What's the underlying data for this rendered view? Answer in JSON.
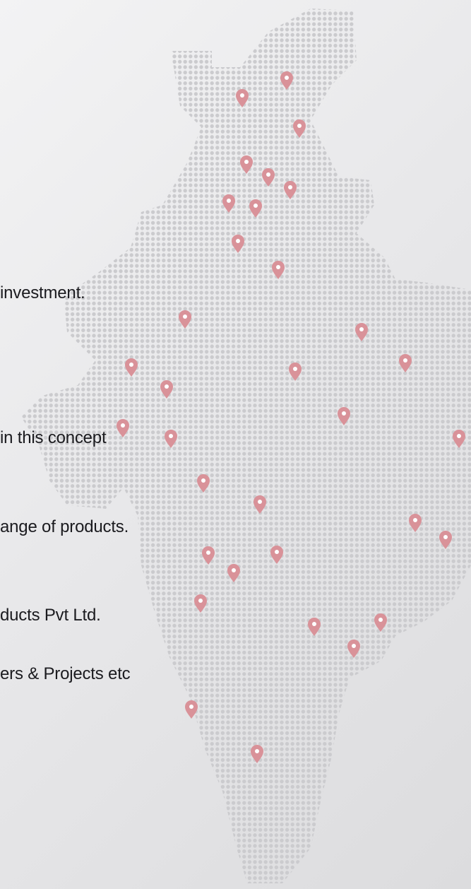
{
  "text_lines": [
    "investment.",
    "in this concept",
    "ange of products.",
    "ducts Pvt Ltd.",
    "ers & Projects etc"
  ],
  "colors": {
    "dot": "#cbcbce",
    "pin": "#d99299",
    "pin_center": "#ffffff",
    "text": "#1b1b1f"
  },
  "icons": {
    "marker": "map-pin-icon"
  }
}
